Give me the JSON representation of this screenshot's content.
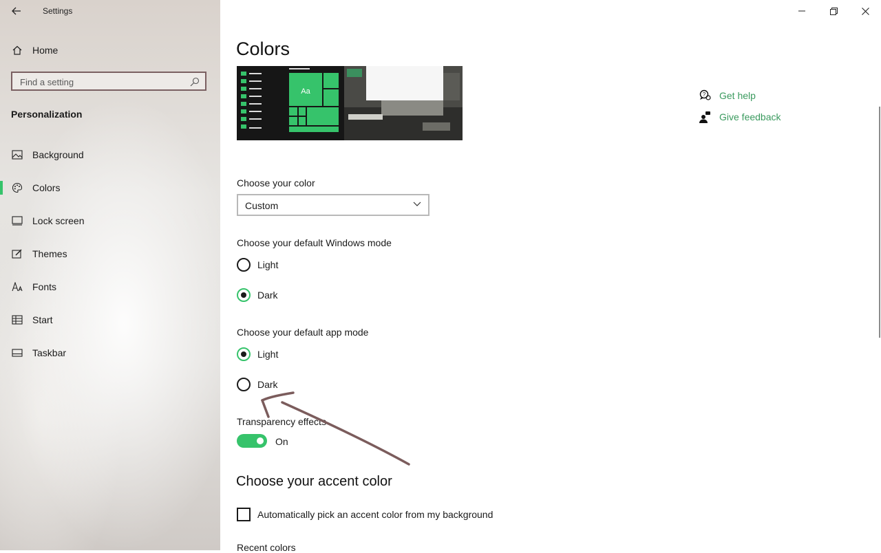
{
  "window": {
    "title": "Settings"
  },
  "sidebar": {
    "home_label": "Home",
    "search_placeholder": "Find a setting",
    "section": "Personalization",
    "items": [
      {
        "label": "Background",
        "icon": "image-icon"
      },
      {
        "label": "Colors",
        "icon": "palette-icon",
        "active": true
      },
      {
        "label": "Lock screen",
        "icon": "lock-screen-icon"
      },
      {
        "label": "Themes",
        "icon": "brush-icon"
      },
      {
        "label": "Fonts",
        "icon": "font-icon"
      },
      {
        "label": "Start",
        "icon": "start-icon"
      },
      {
        "label": "Taskbar",
        "icon": "taskbar-icon"
      }
    ]
  },
  "main": {
    "title": "Colors",
    "preview_tile_text": "Aa",
    "choose_color": {
      "label": "Choose your color",
      "value": "Custom"
    },
    "windows_mode": {
      "label": "Choose your default Windows mode",
      "options": [
        {
          "label": "Light",
          "checked": false
        },
        {
          "label": "Dark",
          "checked": true
        }
      ]
    },
    "app_mode": {
      "label": "Choose your default app mode",
      "options": [
        {
          "label": "Light",
          "checked": true
        },
        {
          "label": "Dark",
          "checked": false
        }
      ]
    },
    "transparency": {
      "label": "Transparency effects",
      "state": "On"
    },
    "accent_heading": "Choose your accent color",
    "auto_accent_label": "Automatically pick an accent color from my background",
    "recent_colors_label": "Recent colors",
    "help_links": {
      "get_help": "Get help",
      "give_feedback": "Give feedback"
    }
  },
  "colors": {
    "accent": "#36c36b",
    "link": "#3a9a5e",
    "annotation": "#7b5c5c"
  }
}
